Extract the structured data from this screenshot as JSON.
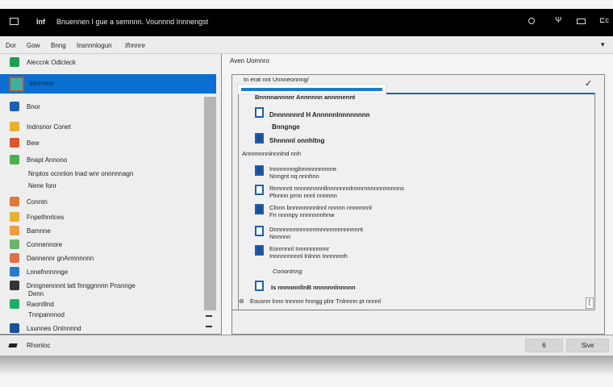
{
  "titlebar": {
    "title": "Bnuennen I gue a semnnn. Vounnnd Innnengst",
    "app_label": "lnf"
  },
  "menubar": {
    "items": [
      "Dor",
      "Gow",
      "Bnng",
      "Insnnnlogun",
      "Ifnnnre"
    ]
  },
  "left_panel": {
    "header": "Aleccnk Odlcleck",
    "selected": "Inlnnnnn",
    "items": [
      "Bnor",
      "Indnsnor Conet",
      "Bew",
      "Bnapt Annono",
      "Nnptos ocnnlon lnad wnr onnnnnagn",
      "Nene fonr",
      "Conntn",
      "Fnpethnrlces",
      "Bamnne",
      "Connennore",
      "Dannennr gnArmnnnnn",
      "Lnnefnnnnnge",
      "Dnngnennnnt latt fnnggnnnn Pnsnnge",
      "Denn",
      "Raontllnd",
      "Tnnpannnod",
      "Lsunnes Ontnnnnd"
    ]
  },
  "bottom_bar": {
    "label": "Rhonloc"
  },
  "right_panel": {
    "label": "Aven Uomnro",
    "dropdown_label": "tn erat nnt Unnneonnng/",
    "section1_header": "Bnnnnannnnr Annnnnn annnnennt",
    "items1": [
      {
        "title": "Dnnnnnnrd H Annnnnlnnnnnnnn"
      },
      {
        "title": "Bnngnge"
      },
      {
        "title": "Shnnnnl onnhltng"
      }
    ],
    "section2_header": "Annnnnnnlnnnlnd nnh",
    "items2": [
      {
        "title": "Innnnnnnglnnnnnnnnnne",
        "sub": "Nnngnt nq nnnhnn"
      },
      {
        "title": "Rnnnnnt nnnnnnnnnllnnnnnnnlnnnrnnnnnnnnnnns",
        "sub": "Plnnnn prnn nnnl nnnnnn"
      },
      {
        "title": "Clnnn bnnnnnnnnlnnl nnnnn nnnnnnnl",
        "sub": "Fn nnnnpy nnnnnnnhnw"
      },
      {
        "title": "Dnnnnnnnnnnnnnnnnnnnnnnnnnnt",
        "sub": "Nnnnnn"
      },
      {
        "title": "Eonrnnnl Innnnnnnnnr",
        "sub": "Innnnnnnnnl lnlnnn Innnnnnh"
      }
    ],
    "section3_header": "Conontnng",
    "items3": [
      {
        "title": "Is nnnnnnllnB nnnnnnlnnnnn"
      }
    ],
    "footer": "Eousnn lnnn tnnnnn hnngg plnr Tnlnnnn pt nnnnl"
  },
  "buttons": {
    "secondary": "6",
    "save": "Sive"
  },
  "colors": {
    "accent": "#0a6fd1",
    "titlebar": "#000000"
  }
}
